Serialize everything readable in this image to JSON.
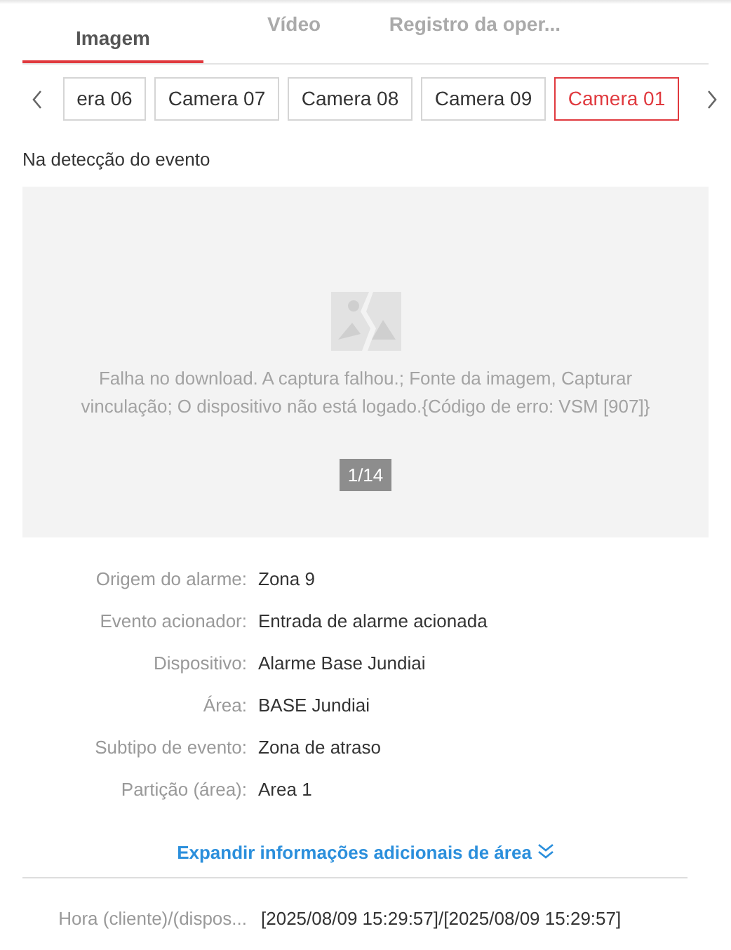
{
  "tabs": [
    {
      "label": "Imagem",
      "selected": true
    },
    {
      "label": "Vídeo",
      "selected": false
    },
    {
      "label": "Registro da oper...",
      "selected": false
    }
  ],
  "cameras": [
    {
      "label": "era 06",
      "selected": false
    },
    {
      "label": "Camera 07",
      "selected": false
    },
    {
      "label": "Camera 08",
      "selected": false
    },
    {
      "label": "Camera 09",
      "selected": false
    },
    {
      "label": "Camera 01",
      "selected": true
    }
  ],
  "section_title": "Na detecção do evento",
  "image_viewer": {
    "error_message": "Falha no download. A captura falhou.; Fonte da imagem, Capturar vinculação; O dispositivo não está logado.{Código de erro: VSM [907]}",
    "counter": "1/14"
  },
  "details": [
    {
      "label": "Origem do alarme:",
      "value": "Zona 9"
    },
    {
      "label": "Evento acionador:",
      "value": "Entrada de alarme acionada"
    },
    {
      "label": "Dispositivo:",
      "value": "Alarme Base Jundiai"
    },
    {
      "label": "Área:",
      "value": "BASE Jundiai"
    },
    {
      "label": "Subtipo de evento:",
      "value": "Zona de atraso"
    },
    {
      "label": "Partição (área):",
      "value": "Area 1"
    }
  ],
  "expand_link": "Expandir informações adicionais de área",
  "time_row": {
    "label": "Hora (cliente)/(dispos...",
    "value": "[2025/08/09 15:29:57]/[2025/08/09 15:29:57]"
  }
}
